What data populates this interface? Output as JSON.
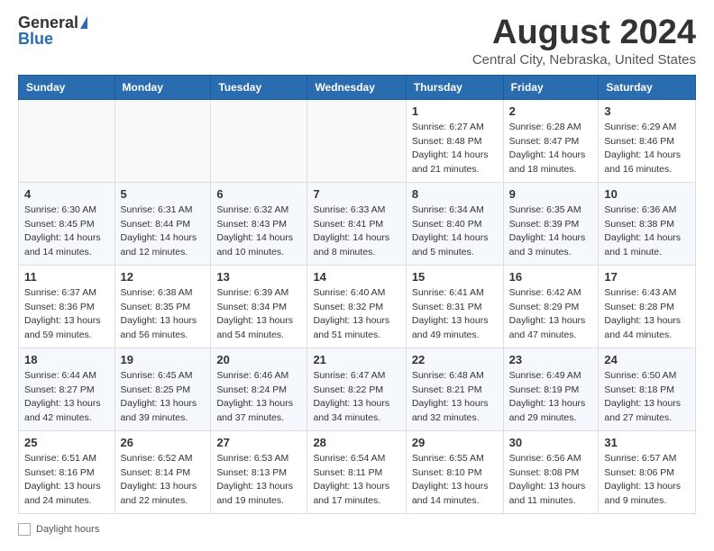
{
  "header": {
    "logo_general": "General",
    "logo_blue": "Blue",
    "month_title": "August 2024",
    "subtitle": "Central City, Nebraska, United States"
  },
  "days_of_week": [
    "Sunday",
    "Monday",
    "Tuesday",
    "Wednesday",
    "Thursday",
    "Friday",
    "Saturday"
  ],
  "weeks": [
    [
      {
        "day": "",
        "info": ""
      },
      {
        "day": "",
        "info": ""
      },
      {
        "day": "",
        "info": ""
      },
      {
        "day": "",
        "info": ""
      },
      {
        "day": "1",
        "info": "Sunrise: 6:27 AM\nSunset: 8:48 PM\nDaylight: 14 hours and 21 minutes."
      },
      {
        "day": "2",
        "info": "Sunrise: 6:28 AM\nSunset: 8:47 PM\nDaylight: 14 hours and 18 minutes."
      },
      {
        "day": "3",
        "info": "Sunrise: 6:29 AM\nSunset: 8:46 PM\nDaylight: 14 hours and 16 minutes."
      }
    ],
    [
      {
        "day": "4",
        "info": "Sunrise: 6:30 AM\nSunset: 8:45 PM\nDaylight: 14 hours and 14 minutes."
      },
      {
        "day": "5",
        "info": "Sunrise: 6:31 AM\nSunset: 8:44 PM\nDaylight: 14 hours and 12 minutes."
      },
      {
        "day": "6",
        "info": "Sunrise: 6:32 AM\nSunset: 8:43 PM\nDaylight: 14 hours and 10 minutes."
      },
      {
        "day": "7",
        "info": "Sunrise: 6:33 AM\nSunset: 8:41 PM\nDaylight: 14 hours and 8 minutes."
      },
      {
        "day": "8",
        "info": "Sunrise: 6:34 AM\nSunset: 8:40 PM\nDaylight: 14 hours and 5 minutes."
      },
      {
        "day": "9",
        "info": "Sunrise: 6:35 AM\nSunset: 8:39 PM\nDaylight: 14 hours and 3 minutes."
      },
      {
        "day": "10",
        "info": "Sunrise: 6:36 AM\nSunset: 8:38 PM\nDaylight: 14 hours and 1 minute."
      }
    ],
    [
      {
        "day": "11",
        "info": "Sunrise: 6:37 AM\nSunset: 8:36 PM\nDaylight: 13 hours and 59 minutes."
      },
      {
        "day": "12",
        "info": "Sunrise: 6:38 AM\nSunset: 8:35 PM\nDaylight: 13 hours and 56 minutes."
      },
      {
        "day": "13",
        "info": "Sunrise: 6:39 AM\nSunset: 8:34 PM\nDaylight: 13 hours and 54 minutes."
      },
      {
        "day": "14",
        "info": "Sunrise: 6:40 AM\nSunset: 8:32 PM\nDaylight: 13 hours and 51 minutes."
      },
      {
        "day": "15",
        "info": "Sunrise: 6:41 AM\nSunset: 8:31 PM\nDaylight: 13 hours and 49 minutes."
      },
      {
        "day": "16",
        "info": "Sunrise: 6:42 AM\nSunset: 8:29 PM\nDaylight: 13 hours and 47 minutes."
      },
      {
        "day": "17",
        "info": "Sunrise: 6:43 AM\nSunset: 8:28 PM\nDaylight: 13 hours and 44 minutes."
      }
    ],
    [
      {
        "day": "18",
        "info": "Sunrise: 6:44 AM\nSunset: 8:27 PM\nDaylight: 13 hours and 42 minutes."
      },
      {
        "day": "19",
        "info": "Sunrise: 6:45 AM\nSunset: 8:25 PM\nDaylight: 13 hours and 39 minutes."
      },
      {
        "day": "20",
        "info": "Sunrise: 6:46 AM\nSunset: 8:24 PM\nDaylight: 13 hours and 37 minutes."
      },
      {
        "day": "21",
        "info": "Sunrise: 6:47 AM\nSunset: 8:22 PM\nDaylight: 13 hours and 34 minutes."
      },
      {
        "day": "22",
        "info": "Sunrise: 6:48 AM\nSunset: 8:21 PM\nDaylight: 13 hours and 32 minutes."
      },
      {
        "day": "23",
        "info": "Sunrise: 6:49 AM\nSunset: 8:19 PM\nDaylight: 13 hours and 29 minutes."
      },
      {
        "day": "24",
        "info": "Sunrise: 6:50 AM\nSunset: 8:18 PM\nDaylight: 13 hours and 27 minutes."
      }
    ],
    [
      {
        "day": "25",
        "info": "Sunrise: 6:51 AM\nSunset: 8:16 PM\nDaylight: 13 hours and 24 minutes."
      },
      {
        "day": "26",
        "info": "Sunrise: 6:52 AM\nSunset: 8:14 PM\nDaylight: 13 hours and 22 minutes."
      },
      {
        "day": "27",
        "info": "Sunrise: 6:53 AM\nSunset: 8:13 PM\nDaylight: 13 hours and 19 minutes."
      },
      {
        "day": "28",
        "info": "Sunrise: 6:54 AM\nSunset: 8:11 PM\nDaylight: 13 hours and 17 minutes."
      },
      {
        "day": "29",
        "info": "Sunrise: 6:55 AM\nSunset: 8:10 PM\nDaylight: 13 hours and 14 minutes."
      },
      {
        "day": "30",
        "info": "Sunrise: 6:56 AM\nSunset: 8:08 PM\nDaylight: 13 hours and 11 minutes."
      },
      {
        "day": "31",
        "info": "Sunrise: 6:57 AM\nSunset: 8:06 PM\nDaylight: 13 hours and 9 minutes."
      }
    ]
  ],
  "footer": {
    "daylight_label": "Daylight hours"
  }
}
